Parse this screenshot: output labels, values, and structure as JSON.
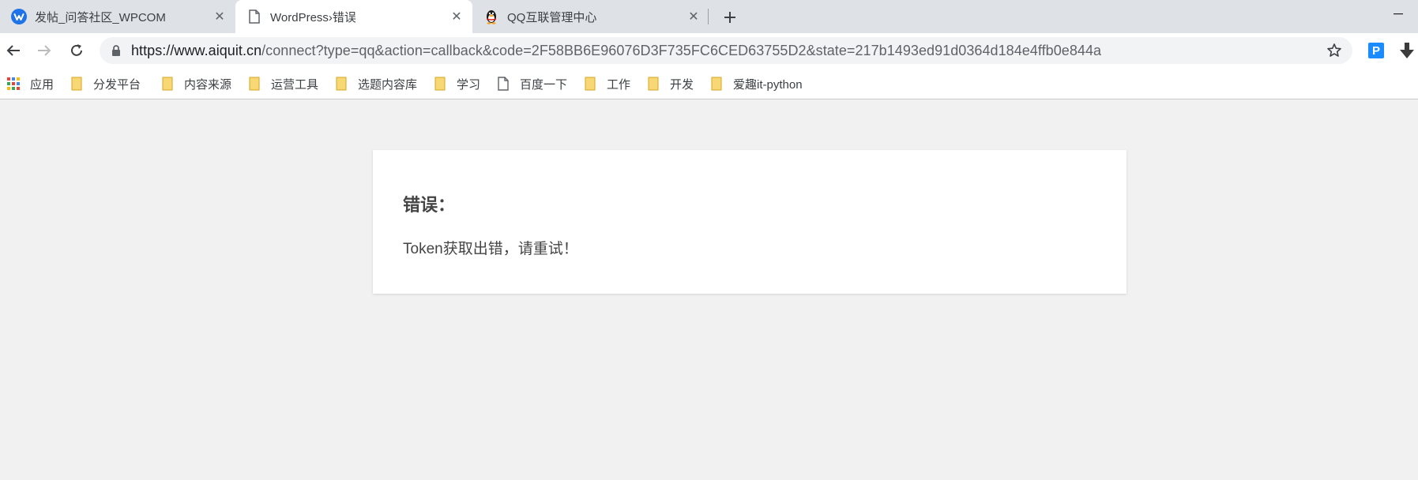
{
  "tabs": [
    {
      "title": "发帖_问答社区_WPCOM",
      "favicon": "wpcom-logo-icon",
      "active": false
    },
    {
      "title": "WordPress›错误",
      "favicon": "document-icon",
      "active": true
    },
    {
      "title": "QQ互联管理中心",
      "favicon": "qq-penguin-icon",
      "active": false
    }
  ],
  "address_bar": {
    "host": "https://www.aiquit.cn",
    "path": "/connect?type=qq&action=callback&code=2F58BB6E96076D3F735FC6CED63755D2&state=217b1493ed91d0364d184e4ffb0e844a"
  },
  "extensions": {
    "p_label": "P"
  },
  "bookmarks": [
    {
      "label": "应用",
      "icon": "apps-grid-icon"
    },
    {
      "label": "分发平台",
      "icon": "folder-icon"
    },
    {
      "label": "内容来源",
      "icon": "folder-icon"
    },
    {
      "label": "运营工具",
      "icon": "folder-icon"
    },
    {
      "label": "选题内容库",
      "icon": "folder-icon"
    },
    {
      "label": "学习",
      "icon": "folder-icon"
    },
    {
      "label": "百度一下",
      "icon": "page-icon"
    },
    {
      "label": "工作",
      "icon": "folder-icon"
    },
    {
      "label": "开发",
      "icon": "folder-icon"
    },
    {
      "label": "爱趣it-python",
      "icon": "folder-icon"
    }
  ],
  "page": {
    "error_title": "错误：",
    "error_message": "Token获取出错，请重试！"
  },
  "colors": {
    "tabstrip_bg": "#dee1e6",
    "page_bg": "#f1f1f1",
    "folder": "#f8d775",
    "extension_p": "#1a8cff"
  }
}
